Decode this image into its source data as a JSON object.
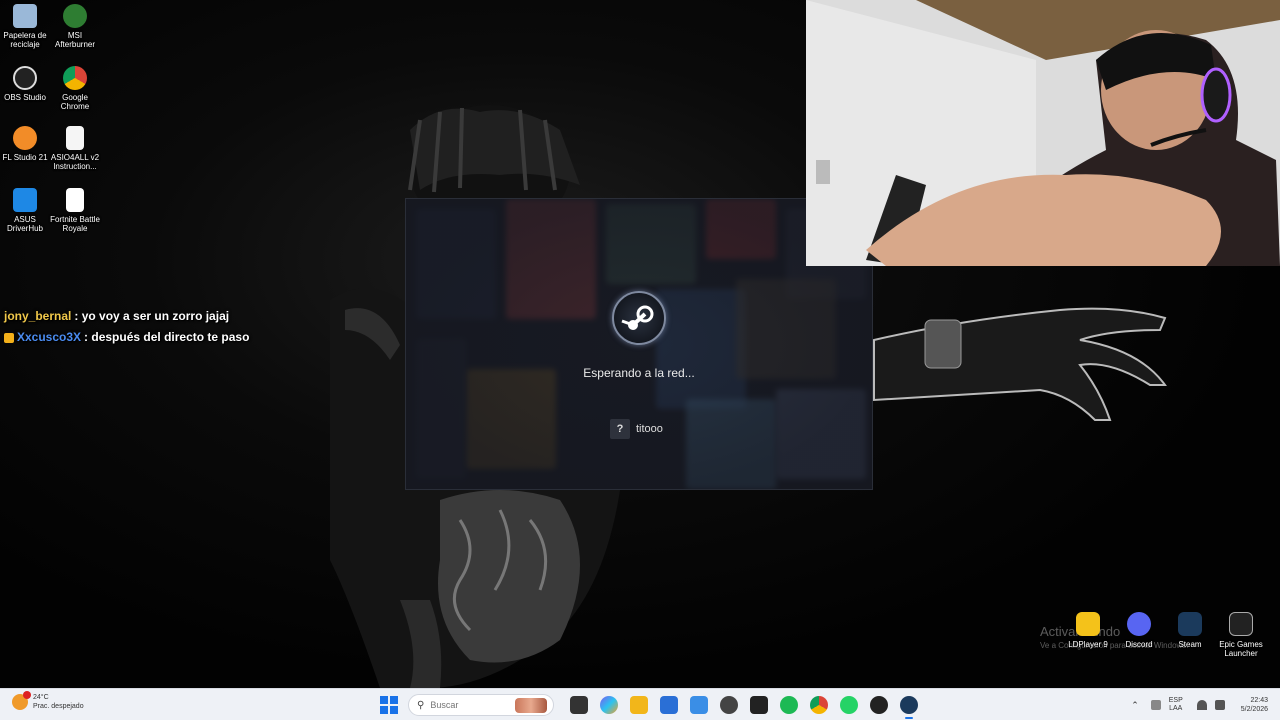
{
  "desktop": {
    "icons": [
      {
        "label": "Papelera de reciclaje",
        "icon": "recycle-bin-icon",
        "color": "#9ab8d8"
      },
      {
        "label": "MSI Afterburner",
        "icon": "msi-afterburner-icon",
        "color": "#2e7d32"
      },
      {
        "label": "OBS Studio",
        "icon": "obs-icon",
        "color": "#222222"
      },
      {
        "label": "Google Chrome",
        "icon": "chrome-icon",
        "color": "#db4437"
      },
      {
        "label": "FL Studio 21",
        "icon": "fl-studio-icon",
        "color": "#f28c28"
      },
      {
        "label": "ASIO4ALL v2 Instruction...",
        "icon": "pdf-document-icon",
        "color": "#f5f5f5"
      },
      {
        "label": "ASUS DriverHub",
        "icon": "asus-driverhub-icon",
        "color": "#1e88e5"
      },
      {
        "label": "Fortnite Battle Royale",
        "icon": "document-icon",
        "color": "#ffffff"
      }
    ],
    "right_icons": [
      {
        "label": "LDPlayer 9",
        "icon": "ldplayer-icon",
        "color": "#f4c21a"
      },
      {
        "label": "Discord",
        "icon": "discord-icon",
        "color": "#5865f2"
      },
      {
        "label": "Steam",
        "icon": "steam-icon",
        "color": "#1b3a5c"
      },
      {
        "label": "Epic Games Launcher",
        "icon": "epic-games-icon",
        "color": "#222222"
      }
    ]
  },
  "chat": {
    "messages": [
      {
        "user": "jony_bernal",
        "text": ": yo voy a ser un zorro jajaj",
        "user_color": "#f0c84a",
        "badge": false
      },
      {
        "user": "Xxcusco3X",
        "text": ": después del directo te paso",
        "user_color": "#4b8cf0",
        "badge": true
      }
    ]
  },
  "steam_dialog": {
    "status": "Esperando a la red...",
    "account_help": "?",
    "account_name": "titooo"
  },
  "watermark": {
    "line1": "Activar Windo",
    "line2": "Ve a Configuración para activar Windows."
  },
  "taskbar": {
    "weather_temp": "24°C",
    "weather_desc": "Prac. despejado",
    "search_placeholder": "Buscar",
    "apps": [
      {
        "icon": "task-view-icon",
        "color": "#333333"
      },
      {
        "icon": "copilot-icon",
        "color": "#7a5cf0"
      },
      {
        "icon": "file-explorer-icon",
        "color": "#f2b61a"
      },
      {
        "icon": "microsoft-store-icon",
        "color": "#2a6fd6"
      },
      {
        "icon": "photos-icon",
        "color": "#3a8ee6"
      },
      {
        "icon": "app-dark-icon",
        "color": "#444444"
      },
      {
        "icon": "epic-games-icon",
        "color": "#222222"
      },
      {
        "icon": "spotify-icon",
        "color": "#1db954"
      },
      {
        "icon": "chrome-icon",
        "color": "#db4437"
      },
      {
        "icon": "whatsapp-icon",
        "color": "#25d366"
      },
      {
        "icon": "obs-icon",
        "color": "#222222"
      },
      {
        "icon": "steam-icon",
        "color": "#1b3a5c"
      }
    ],
    "lang_top": "ESP",
    "lang_bottom": "LAA",
    "time": "22:43",
    "date": "5/2/2026"
  }
}
